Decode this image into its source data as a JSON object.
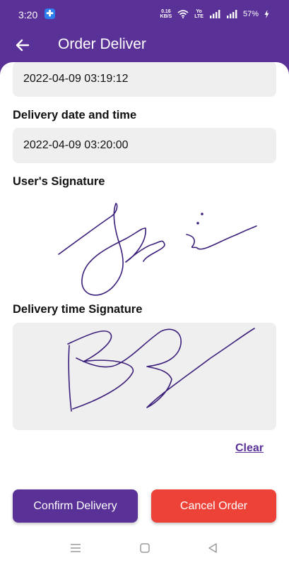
{
  "status_bar": {
    "time": "3:20",
    "net_speed_value": "0.16",
    "net_speed_unit": "KB/S",
    "volte_top": "Yo",
    "volte_bottom": "LTE",
    "battery_percent": "57%"
  },
  "app_bar": {
    "title": "Order Deliver",
    "back_icon": "arrow-left-icon"
  },
  "form": {
    "first_datetime_value": "2022-04-09 03:19:12",
    "delivery_label": "Delivery date and time",
    "delivery_datetime_value": "2022-04-09 03:20:00",
    "user_signature_label": "User's Signature",
    "delivery_signature_label": "Delivery time Signature",
    "clear_label": "Clear"
  },
  "actions": {
    "confirm_label": "Confirm Delivery",
    "cancel_label": "Cancel Order"
  },
  "colors": {
    "primary": "#5a3196",
    "danger": "#ec4237",
    "field_bg": "#efefef",
    "ink": "#3b1f7a"
  }
}
